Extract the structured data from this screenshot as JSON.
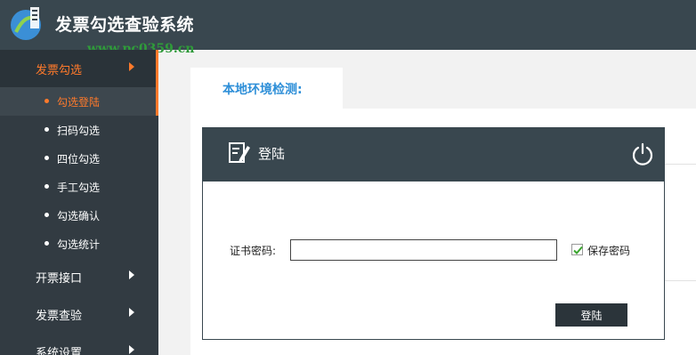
{
  "header": {
    "title": "发票勾选查验系统",
    "watermark_url": "www.pc0359.cn",
    "logo_icon": "watermark-logo-icon"
  },
  "sidebar": {
    "groups": [
      {
        "label": "发票勾选",
        "state": "expanded"
      },
      {
        "label": "开票接口",
        "state": "collapsed"
      },
      {
        "label": "发票查验",
        "state": "collapsed"
      },
      {
        "label": "系统设置",
        "state": "collapsed"
      }
    ],
    "sub_items": [
      {
        "label": "勾选登陆",
        "active": true
      },
      {
        "label": "扫码勾选"
      },
      {
        "label": "四位勾选"
      },
      {
        "label": "手工勾选"
      },
      {
        "label": "勾选确认"
      },
      {
        "label": "勾选统计"
      }
    ]
  },
  "main": {
    "tab_label": "本地环境检测:"
  },
  "dialog": {
    "title": "登陆",
    "password_label": "证书密码:",
    "password_value": "",
    "save_password_label": "保存密码",
    "save_password_checked": true,
    "login_button": "登陆"
  },
  "colors": {
    "header_bg": "#39474f",
    "sidebar_bg": "#323b42",
    "accent": "#ff7a2b",
    "tab_text": "#2e8fd8",
    "button_bg": "#2b343a"
  }
}
